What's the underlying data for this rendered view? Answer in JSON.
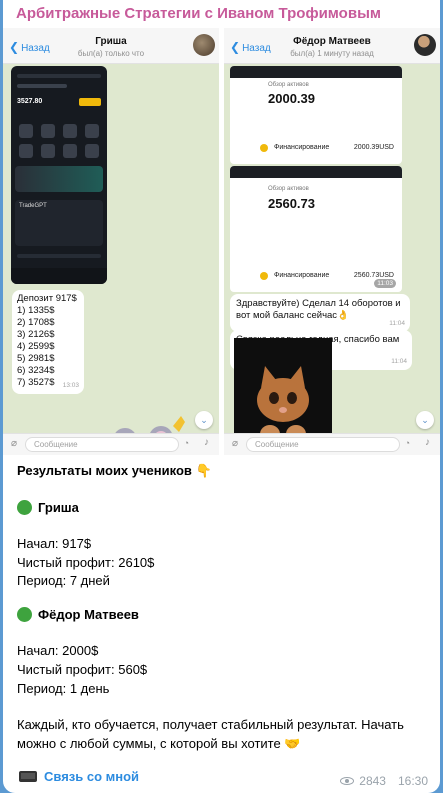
{
  "channel": {
    "title": "Арбитражные Стратегии с Иваном Трофимовым"
  },
  "left_chat": {
    "back_label": "Назад",
    "name": "Гриша",
    "status": "был(а) только что",
    "screenshot": {
      "balance": "3527.80",
      "trade_title": "TradeGPT"
    },
    "deposit_message": {
      "lines": [
        "Депозит 917$",
        "1) 1335$",
        "2) 1708$",
        "3) 2126$",
        "4) 2599$",
        "5) 2981$",
        "6) 3234$",
        "7) 3527$"
      ],
      "time": "13:03"
    },
    "input_placeholder": "Сообщение"
  },
  "right_chat": {
    "back_label": "Назад",
    "name": "Фёдор Матвеев",
    "status": "был(а) 1 минуту назад",
    "screenshot_1": {
      "header": "Обзор активов",
      "amount": "2000.39",
      "row_label": "Финансирование",
      "row_value": "2000.39USD"
    },
    "screenshot_2": {
      "header": "Обзор активов",
      "amount": "2560.73",
      "row_label": "Финансирование",
      "row_value": "2560.73USD",
      "time": "11:03"
    },
    "message_1": {
      "text_1": "Здравствуйте) Сделал 14 оборотов и",
      "text_2": "вот мой баланс сейчас👌",
      "time": "11:04"
    },
    "message_2": {
      "text": "Связка реально годная, спасибо вам 🥰",
      "time": "11:04"
    },
    "input_placeholder": "Сообщение"
  },
  "post": {
    "heading": "Результаты моих учеников 👇",
    "student_1": {
      "name": "Гриша",
      "start": "Начал: 917$",
      "profit": "Чистый профит: 2610$",
      "period": "Период: 7 дней"
    },
    "student_2": {
      "name": "Фёдор Матвеев",
      "start": "Начал: 2000$",
      "profit": "Чистый профит: 560$",
      "period": "Период: 1 день"
    },
    "summary_1": "Каждый, кто обучается, получает стабильный результат. Начать",
    "summary_2": "можно с любой суммы, с которой вы хотите 🤝",
    "link_label": "Связь со мной",
    "views": "2843",
    "time": "16:30"
  },
  "colors": {
    "background": "#5c9ad2",
    "title": "#c75a9a",
    "link": "#2d8ce0",
    "chat_bg": "#dfe8cf"
  }
}
